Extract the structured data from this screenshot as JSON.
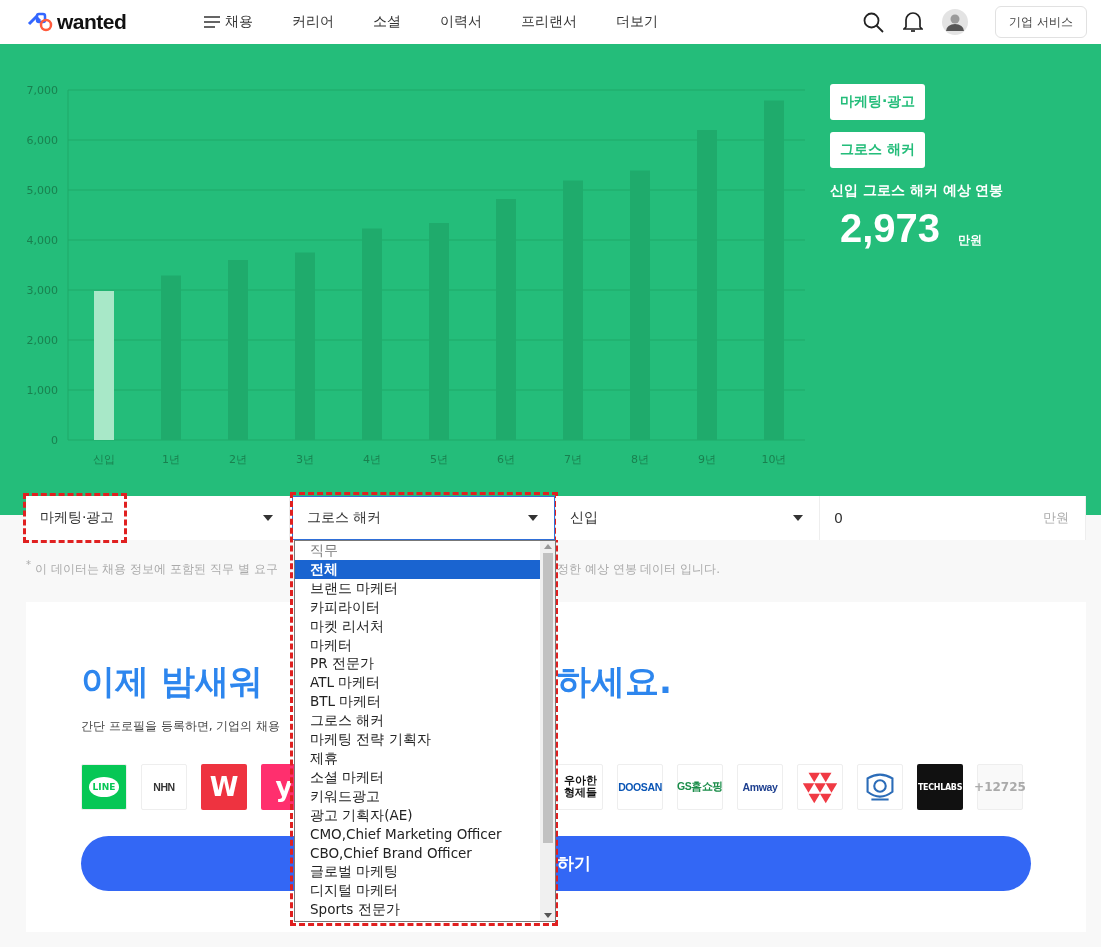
{
  "header": {
    "logo": "wanted",
    "nav": [
      {
        "label": "채용",
        "kind": "menu"
      },
      {
        "label": "커리어",
        "kind": "link"
      },
      {
        "label": "소셜",
        "kind": "link"
      },
      {
        "label": "이력서",
        "kind": "link"
      },
      {
        "label": "프리랜서",
        "kind": "link"
      },
      {
        "label": "더보기",
        "kind": "link"
      }
    ],
    "corporate_button": "기업 서비스"
  },
  "chart_data": {
    "type": "bar",
    "categories": [
      "신입",
      "1년",
      "2년",
      "3년",
      "4년",
      "5년",
      "6년",
      "7년",
      "8년",
      "9년",
      "10년"
    ],
    "series": [
      {
        "color": "#a8e8c8",
        "values": [
          2980,
          null,
          null,
          null,
          null,
          null,
          null,
          null,
          null,
          null,
          null
        ]
      },
      {
        "color": "#1fab6c",
        "values": [
          null,
          3290,
          3600,
          3750,
          4230,
          4340,
          4820,
          5190,
          5390,
          6200,
          6790
        ]
      }
    ],
    "grid": true,
    "ylim": [
      0,
      7000
    ],
    "yticks": [
      {
        "value": 0,
        "label": "0"
      },
      {
        "value": 1000,
        "label": "1,000"
      },
      {
        "value": 2000,
        "label": "2,000"
      },
      {
        "value": 3000,
        "label": "3,000"
      },
      {
        "value": 4000,
        "label": "4,000"
      },
      {
        "value": 5000,
        "label": "5,000"
      },
      {
        "value": 6000,
        "label": "6,000"
      },
      {
        "value": 7000,
        "label": "7,000"
      }
    ],
    "xlabel": null
  },
  "summary": {
    "tags": [
      "마케팅·광고",
      "그로스 해커"
    ],
    "caption": "신입 그로스 해커 예상 연봉",
    "amount": "2,973",
    "unit": "만원"
  },
  "filters": [
    {
      "kind": "select",
      "value": "마케팅·광고",
      "highlighted": true,
      "expanded": false
    },
    {
      "kind": "select",
      "value": "그로스 해커",
      "highlighted": true,
      "expanded": true
    },
    {
      "kind": "select",
      "value": "신입",
      "highlighted": false,
      "expanded": false
    },
    {
      "kind": "input",
      "value": "0",
      "unit": "만원",
      "highlighted": false,
      "expanded": false
    }
  ],
  "dropdown": {
    "options": [
      {
        "label": "직무",
        "selected": false,
        "disabled": true
      },
      {
        "label": "전체",
        "selected": true,
        "disabled": false
      },
      {
        "label": "브랜드 마케터",
        "selected": false,
        "disabled": false
      },
      {
        "label": "카피라이터",
        "selected": false,
        "disabled": false
      },
      {
        "label": "마켓 리서처",
        "selected": false,
        "disabled": false
      },
      {
        "label": "마케터",
        "selected": false,
        "disabled": false
      },
      {
        "label": "PR 전문가",
        "selected": false,
        "disabled": false
      },
      {
        "label": "ATL 마케터",
        "selected": false,
        "disabled": false
      },
      {
        "label": "BTL 마케터",
        "selected": false,
        "disabled": false
      },
      {
        "label": "그로스 해커",
        "selected": false,
        "disabled": false
      },
      {
        "label": "마케팅 전략 기획자",
        "selected": false,
        "disabled": false
      },
      {
        "label": "제휴",
        "selected": false,
        "disabled": false
      },
      {
        "label": "소셜 마케터",
        "selected": false,
        "disabled": false
      },
      {
        "label": "키워드광고",
        "selected": false,
        "disabled": false
      },
      {
        "label": "광고 기획자(AE)",
        "selected": false,
        "disabled": false
      },
      {
        "label": "CMO,Chief Marketing Officer",
        "selected": false,
        "disabled": false
      },
      {
        "label": "CBO,Chief Brand Officer",
        "selected": false,
        "disabled": false
      },
      {
        "label": "글로벌 마케팅",
        "selected": false,
        "disabled": false
      },
      {
        "label": "디지털 마케터",
        "selected": false,
        "disabled": false
      },
      {
        "label": "Sports 전문가",
        "selected": false,
        "disabled": false
      }
    ]
  },
  "note": {
    "mark": "*",
    "left": "이 데이터는 채용 정보에 포함된 직무 별 요구",
    "right": "정한 예상 연봉 데이터 입니다."
  },
  "promo": {
    "heading_left": "이제 밤새워",
    "heading_right": "하세요.",
    "subtitle_left": "간단 프로필을 등록하면, 기업의 채용",
    "logos_left": [
      {
        "kind": "badge",
        "label": "LINE",
        "color": "#06c755"
      },
      {
        "kind": "wordmark",
        "label": "NHN",
        "color": "#333333"
      },
      {
        "kind": "tile",
        "label": "W",
        "color": "#ee3340"
      },
      {
        "kind": "tile",
        "label": "y",
        "color": "#ff2f6e"
      }
    ],
    "logos_right": [
      {
        "kind": "stacked",
        "label": "우아한 형제들",
        "color": "#111111"
      },
      {
        "kind": "wordmark",
        "label": "DOOSAN",
        "color": "#0a55b5"
      },
      {
        "kind": "wordmark",
        "label": "GS홈쇼핑",
        "color": "#1b8d4a"
      },
      {
        "kind": "wordmark",
        "label": "Amway",
        "color": "#1d3f8f"
      },
      {
        "kind": "triangles",
        "color": "#f03a44"
      },
      {
        "kind": "crest",
        "color": "#2b6cb8"
      },
      {
        "kind": "tile",
        "label": "TECHLABS",
        "color": "#111111"
      },
      {
        "kind": "count",
        "label": "+12725",
        "color": "#aaaaaa"
      }
    ],
    "button_right": "하기"
  }
}
